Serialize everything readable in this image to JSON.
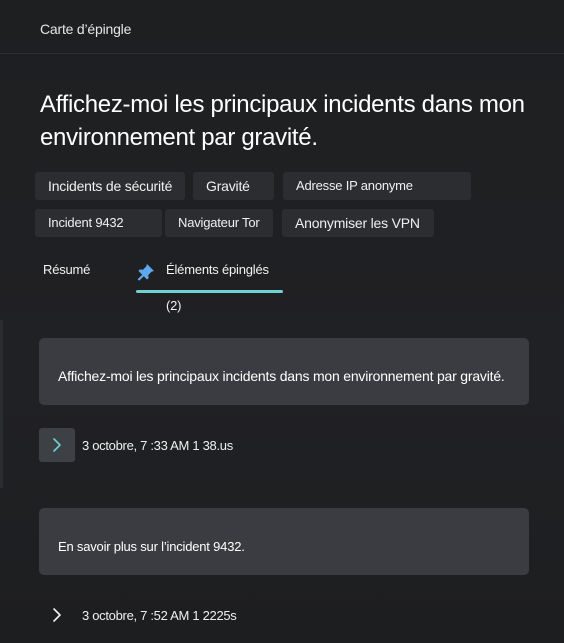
{
  "header": {
    "title": "Carte d’épingle"
  },
  "headline": "Affichez-moi les principaux incidents dans mon environnement par gravité.",
  "chips": [
    "Incidents de sécurité",
    "Gravité",
    "Adresse IP anonyme",
    "Incident 9432",
    "Navigateur Tor",
    "Anonymiser les VPN"
  ],
  "tabs": {
    "summary": "Résumé",
    "pinned": "Éléments épinglés (2)"
  },
  "items": [
    {
      "prompt": "Affichez-moi les principaux incidents dans mon environnement par gravité.",
      "meta": "3 octobre, 7 :33 AM 1 38.us"
    },
    {
      "prompt": "En savoir plus sur l’incident 9432.",
      "meta": "3 octobre, 7 :52 AM 1 2225s"
    }
  ],
  "icons": {
    "pin": "pin-icon",
    "expand": "chevron-right-icon"
  },
  "colors": {
    "accent": "#6fd1d1",
    "background": "#1e1f21",
    "card": "#3b3c41",
    "chip": "#2c2d31"
  }
}
